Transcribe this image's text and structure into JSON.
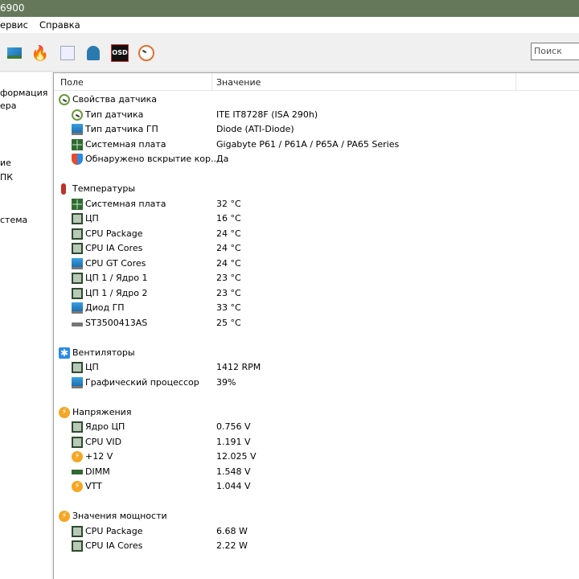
{
  "window": {
    "title": "6900"
  },
  "menu": [
    "ервис",
    "Справка"
  ],
  "toolbar": {
    "icons": [
      "network-card-icon",
      "flame-icon",
      "services-icon",
      "users-icon",
      "osd-icon",
      "gauge-icon"
    ],
    "osd_label": "OSD",
    "search_placeholder": "Поиск"
  },
  "sidebar": {
    "items": [
      "формация",
      "ера",
      "ие",
      "ПК",
      "стема"
    ]
  },
  "table": {
    "columns": [
      "Поле",
      "Значение"
    ],
    "rows": [
      {
        "level": 0,
        "icon": "gauge",
        "field": "Свойства датчика",
        "value": ""
      },
      {
        "level": 1,
        "icon": "gauge",
        "field": "Тип датчика",
        "value": "ITE IT8728F  (ISA 290h)"
      },
      {
        "level": 1,
        "icon": "monitor",
        "field": "Тип датчика ГП",
        "value": "Diode  (ATI-Diode)"
      },
      {
        "level": 1,
        "icon": "motherboard",
        "field": "Системная плата",
        "value": "Gigabyte P61 / P61A / P65A / PA65 Series"
      },
      {
        "level": 1,
        "icon": "shield",
        "field": "Обнаружено вскрытие кор...",
        "value": "Да"
      },
      null,
      {
        "level": 0,
        "icon": "thermometer",
        "field": "Температуры",
        "value": ""
      },
      {
        "level": 1,
        "icon": "motherboard",
        "field": "Системная плата",
        "value": "32 °C"
      },
      {
        "level": 1,
        "icon": "chip",
        "field": "ЦП",
        "value": "16 °C"
      },
      {
        "level": 1,
        "icon": "chip",
        "field": "CPU Package",
        "value": "24 °C"
      },
      {
        "level": 1,
        "icon": "chip",
        "field": "CPU IA Cores",
        "value": "24 °C"
      },
      {
        "level": 1,
        "icon": "monitor",
        "field": "CPU GT Cores",
        "value": "24 °C"
      },
      {
        "level": 1,
        "icon": "chip",
        "field": "ЦП 1 / Ядро 1",
        "value": "23 °C"
      },
      {
        "level": 1,
        "icon": "chip",
        "field": "ЦП 1 / Ядро 2",
        "value": "23 °C"
      },
      {
        "level": 1,
        "icon": "monitor",
        "field": "Диод ГП",
        "value": "33 °C"
      },
      {
        "level": 1,
        "icon": "hdd",
        "field": "ST3500413AS",
        "value": "25 °C"
      },
      null,
      {
        "level": 0,
        "icon": "fan",
        "field": "Вентиляторы",
        "value": ""
      },
      {
        "level": 1,
        "icon": "chip",
        "field": "ЦП",
        "value": "1412 RPM"
      },
      {
        "level": 1,
        "icon": "monitor",
        "field": "Графический процессор",
        "value": "39%"
      },
      null,
      {
        "level": 0,
        "icon": "bolt",
        "field": "Напряжения",
        "value": ""
      },
      {
        "level": 1,
        "icon": "chip",
        "field": "Ядро ЦП",
        "value": "0.756 V"
      },
      {
        "level": 1,
        "icon": "chip",
        "field": "CPU VID",
        "value": "1.191 V"
      },
      {
        "level": 1,
        "icon": "bolt",
        "field": "+12 V",
        "value": "12.025 V"
      },
      {
        "level": 1,
        "icon": "dimm",
        "field": "DIMM",
        "value": "1.548 V"
      },
      {
        "level": 1,
        "icon": "bolt",
        "field": "VTT",
        "value": "1.044 V"
      },
      null,
      {
        "level": 0,
        "icon": "bolt",
        "field": "Значения мощности",
        "value": ""
      },
      {
        "level": 1,
        "icon": "chip",
        "field": "CPU Package",
        "value": "6.68 W"
      },
      {
        "level": 1,
        "icon": "chip",
        "field": "CPU IA Cores",
        "value": "2.22 W"
      }
    ]
  }
}
